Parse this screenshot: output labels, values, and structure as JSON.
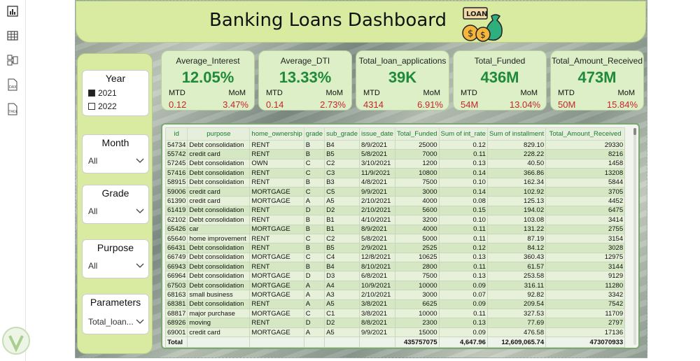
{
  "report": {
    "title": "Banking Loans Dashboard",
    "logo_text": "LOAN"
  },
  "rail": {
    "icons": [
      "report-view-icon",
      "table-view-icon",
      "model-view-icon",
      "dax-query-icon",
      "tmdl-view-icon"
    ]
  },
  "slicers": {
    "year": {
      "title": "Year",
      "options": [
        {
          "label": "2021",
          "checked": true
        },
        {
          "label": "2022",
          "checked": false
        }
      ]
    },
    "month": {
      "title": "Month",
      "value": "All"
    },
    "grade": {
      "title": "Grade",
      "value": "All"
    },
    "purpose": {
      "title": "Purpose",
      "value": "All"
    },
    "parameters": {
      "title": "Parameters",
      "value": "Total_loan..."
    }
  },
  "kpis": [
    {
      "title": "Average_Interest",
      "value": "12.05%",
      "mtd_label": "MTD",
      "mom_label": "MoM",
      "mtd": "0.12",
      "mom": "3.47%"
    },
    {
      "title": "Average_DTI",
      "value": "13.33%",
      "mtd_label": "MTD",
      "mom_label": "MoM",
      "mtd": "0.14",
      "mom": "2.73%"
    },
    {
      "title": "Total_loan_applications",
      "value": "39K",
      "mtd_label": "MTD",
      "mom_label": "MoM",
      "mtd": "4314",
      "mom": "6.91%"
    },
    {
      "title": "Total_Funded",
      "value": "436M",
      "mtd_label": "MTD",
      "mom_label": "MoM",
      "mtd": "54M",
      "mom": "13.04%"
    },
    {
      "title": "Total_Amount_Received",
      "value": "473M",
      "mtd_label": "MTD",
      "mom_label": "MoM",
      "mtd": "50M",
      "mom": "15.84%"
    }
  ],
  "table": {
    "columns": [
      "id",
      "purpose",
      "home_ownership",
      "grade",
      "sub_grade",
      "issue_date",
      "Total_Funded",
      "Sum of int_rate",
      "Sum of installment",
      "Total_Amount_Received"
    ],
    "rows": [
      [
        "54734",
        "Debt consolidation",
        "RENT",
        "B",
        "B4",
        "8/9/2021",
        "25000",
        "0.12",
        "829.10",
        "29330"
      ],
      [
        "55742",
        "credit card",
        "RENT",
        "B",
        "B5",
        "5/8/2021",
        "7000",
        "0.11",
        "228.22",
        "8216"
      ],
      [
        "57245",
        "Debt consolidation",
        "OWN",
        "C",
        "C2",
        "3/10/2021",
        "1200",
        "0.13",
        "40.50",
        "1458"
      ],
      [
        "57416",
        "Debt consolidation",
        "RENT",
        "C",
        "C3",
        "11/9/2021",
        "10800",
        "0.14",
        "366.86",
        "13208"
      ],
      [
        "58915",
        "Debt consolidation",
        "RENT",
        "B",
        "B3",
        "4/8/2021",
        "7500",
        "0.10",
        "162.34",
        "5844"
      ],
      [
        "59006",
        "credit card",
        "MORTGAGE",
        "C",
        "C5",
        "9/9/2021",
        "3000",
        "0.14",
        "102.92",
        "3705"
      ],
      [
        "61390",
        "credit card",
        "MORTGAGE",
        "A",
        "A5",
        "2/10/2021",
        "4000",
        "0.08",
        "125.13",
        "4452"
      ],
      [
        "61419",
        "Debt consolidation",
        "RENT",
        "D",
        "D2",
        "2/10/2021",
        "5600",
        "0.15",
        "194.02",
        "6475"
      ],
      [
        "62102",
        "Debt consolidation",
        "RENT",
        "B",
        "B1",
        "4/10/2021",
        "3200",
        "0.10",
        "103.08",
        "3414"
      ],
      [
        "65426",
        "car",
        "MORTGAGE",
        "B",
        "B1",
        "8/9/2021",
        "4000",
        "0.11",
        "131.22",
        "2755"
      ],
      [
        "65640",
        "home improvement",
        "RENT",
        "C",
        "C2",
        "5/8/2021",
        "5000",
        "0.11",
        "87.19",
        "3154"
      ],
      [
        "66431",
        "Debt consolidation",
        "RENT",
        "B",
        "B5",
        "2/9/2021",
        "2525",
        "0.12",
        "84.12",
        "3028"
      ],
      [
        "66749",
        "Debt consolidation",
        "MORTGAGE",
        "C",
        "C4",
        "12/8/2021",
        "10625",
        "0.13",
        "360.43",
        "12975"
      ],
      [
        "66943",
        "Debt consolidation",
        "RENT",
        "B",
        "B4",
        "8/10/2021",
        "2800",
        "0.11",
        "61.57",
        "3144"
      ],
      [
        "66964",
        "Debt consolidation",
        "MORTGAGE",
        "D",
        "D3",
        "6/8/2021",
        "7500",
        "0.13",
        "253.58",
        "9129"
      ],
      [
        "67503",
        "Debt consolidation",
        "MORTGAGE",
        "A",
        "A4",
        "10/9/2021",
        "10000",
        "0.09",
        "316.11",
        "11280"
      ],
      [
        "68163",
        "small business",
        "MORTGAGE",
        "A",
        "A3",
        "2/10/2021",
        "3000",
        "0.07",
        "92.82",
        "3342"
      ],
      [
        "68381",
        "Debt consolidation",
        "RENT",
        "A",
        "A5",
        "3/8/2021",
        "6625",
        "0.09",
        "209.54",
        "7542"
      ],
      [
        "68817",
        "major purchase",
        "MORTGAGE",
        "C",
        "C1",
        "3/8/2021",
        "10000",
        "0.11",
        "327.53",
        "11709"
      ],
      [
        "68926",
        "moving",
        "RENT",
        "D",
        "D2",
        "8/8/2021",
        "2300",
        "0.13",
        "77.69",
        "2797"
      ],
      [
        "69001",
        "credit card",
        "MORTGAGE",
        "A",
        "A5",
        "9/9/2021",
        "15000",
        "0.09",
        "476.58",
        "17136"
      ]
    ],
    "total": {
      "label": "Total",
      "total_funded": "435757075",
      "int_rate": "4,647.96",
      "installment": "12,609,065.74",
      "amount_received": "473070933"
    }
  }
}
